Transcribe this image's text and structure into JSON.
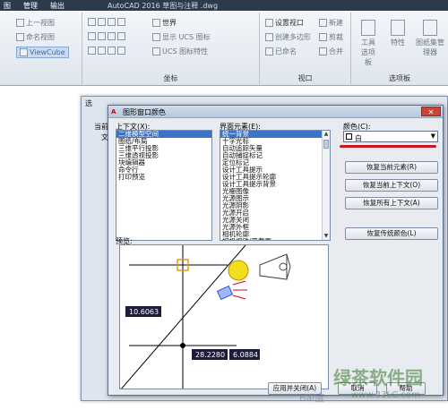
{
  "titlebar": {
    "tabs": [
      "图",
      "管理",
      "输出"
    ],
    "title": "AutoCAD 2016    草图与注释 .dwg"
  },
  "ribbon": {
    "view_items": [
      "上一视图",
      "命名视图",
      "ViewCube"
    ],
    "coord_items": [
      "世界",
      "显示 UCS 图标",
      "UCS 图标特性"
    ],
    "coord_label": "坐标",
    "viewport_items": [
      "设置视口",
      "创建多边形",
      "已命名",
      "新建",
      "剪裁",
      "合并"
    ],
    "viewport_label": "视口",
    "palette_items": [
      "工具选项板",
      "特性",
      "图纸集管理器"
    ],
    "palette_label": "选项板"
  },
  "outer_dialog": {
    "title": "选",
    "pane_label": "当前",
    "pane_tab": "文"
  },
  "dialog": {
    "title": "图形窗口颜色",
    "context_label": "上下文(X):",
    "context_items": [
      "二维模型空间",
      "图纸/布局",
      "三维平行投影",
      "三维透视投影",
      "块编辑器",
      "命令行",
      "打印预览"
    ],
    "context_selected": 0,
    "element_label": "界面元素(E):",
    "element_items": [
      "统一背景",
      "十字光标",
      "自动追踪矢量",
      "自动捕捉标记",
      "定位标记",
      "设计工具提示",
      "设计工具提示轮廓",
      "设计工具提示背景",
      "光栅图像",
      "光源图示",
      "光源阴影",
      "光源开启",
      "光源关闭",
      "光源外框",
      "相机轮廓",
      "相机视锥/平截面",
      "相机剪裁平面",
      "光域网"
    ],
    "element_selected": 0,
    "color_label": "颜色(C):",
    "color_value": "白",
    "buttons": {
      "restore_element": "恢复当前元素(R)",
      "restore_context": "恢复当前上下文(O)",
      "restore_all": "恢复所有上下文(A)",
      "restore_classic": "恢复传统颜色(L)"
    },
    "preview_label": "预览:",
    "preview_values": [
      "10.6063",
      "28.2280",
      "6.0884"
    ],
    "footer": {
      "apply": "应用并关闭(A)",
      "cancel": "取消",
      "help": "帮助"
    }
  },
  "watermark": {
    "main": "绿茶软件园",
    "sub": "www.33LC.com",
    "baidu": "Bai度"
  }
}
